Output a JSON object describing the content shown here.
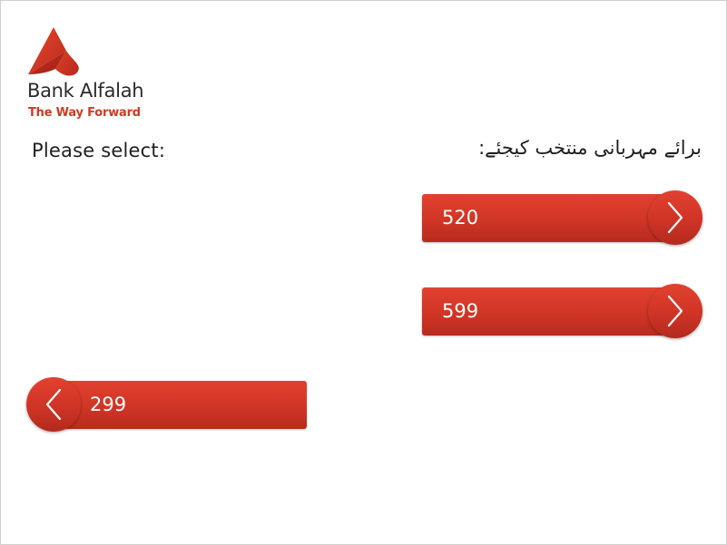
{
  "logo": {
    "name": "Bank Alfalah",
    "tagline": "The Way Forward",
    "brand_color": "#d23a23"
  },
  "prompt": {
    "english": "Please select:",
    "urdu": "برائے مہربانی منتخب کیجئے:"
  },
  "options": {
    "right_1": {
      "label": "520",
      "icon": "chevron-right-icon"
    },
    "right_2": {
      "label": "599",
      "icon": "chevron-right-icon"
    },
    "left_1": {
      "label": "299",
      "icon": "chevron-left-icon"
    }
  },
  "colors": {
    "button_top": "#e2412f",
    "button_bottom": "#b72b1f",
    "text": "#1f1f1f"
  }
}
